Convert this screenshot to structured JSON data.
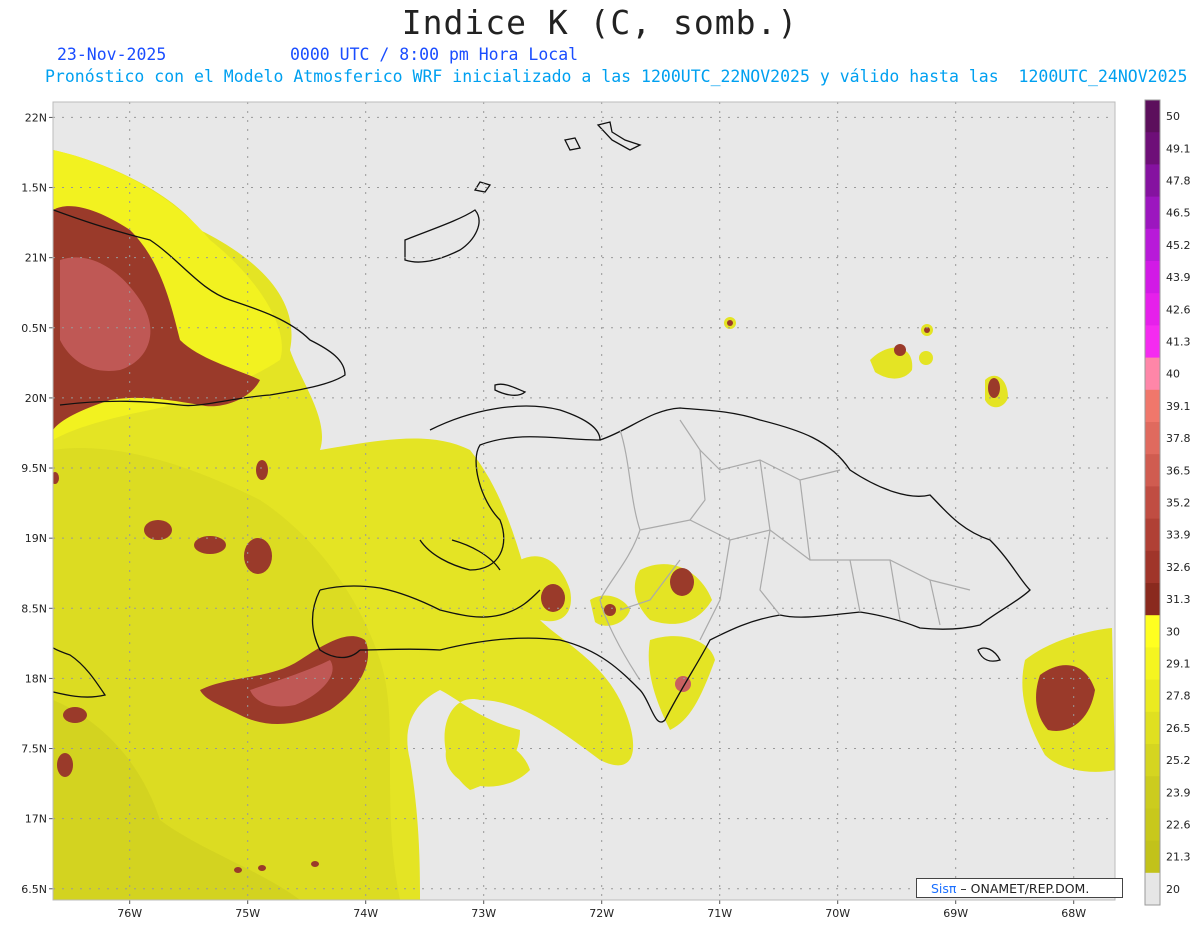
{
  "title": "Indice K (C, somb.)",
  "date": "23-Nov-2025",
  "time": "0000 UTC / 8:00 pm Hora Local",
  "forecast": "Pronóstico con el Modelo Atmosferico WRF inicializado a las 1200UTC_22NOV2025 y válido hasta las  1200UTC_24NOV2025",
  "credit_prefix": "Sisπ",
  "credit_suffix": " – ONAMET/REP.DOM.",
  "map": {
    "lat_range": [
      16.42,
      22.11
    ],
    "lon_range": [
      -76.65,
      -67.65
    ],
    "lat_labels": [
      "22N",
      "1.5N",
      "21N",
      "0.5N",
      "20N",
      "9.5N",
      "19N",
      "8.5N",
      "18N",
      "7.5N",
      "17N",
      "6.5N"
    ],
    "lat_values": [
      22,
      21.5,
      21,
      20.5,
      20,
      19.5,
      19,
      18.5,
      18,
      17.5,
      17,
      16.5
    ],
    "lon_labels": [
      "76W",
      "75W",
      "74W",
      "73W",
      "72W",
      "71W",
      "70W",
      "69W",
      "68W"
    ],
    "lon_values": [
      -76,
      -75,
      -74,
      -73,
      -72,
      -71,
      -70,
      -69,
      -68
    ],
    "background_color": "#e8e8e8"
  },
  "colorbar": {
    "levels": [
      "50",
      "49.1",
      "47.8",
      "46.5",
      "45.2",
      "43.9",
      "42.6",
      "41.3",
      "40",
      "39.1",
      "37.8",
      "36.5",
      "35.2",
      "33.9",
      "32.6",
      "31.3",
      "30",
      "29.1",
      "27.8",
      "26.5",
      "25.2",
      "23.9",
      "22.6",
      "21.3",
      "20"
    ],
    "colors_top_to_bottom": [
      "#5c0f5c",
      "#6e0f78",
      "#8512a0",
      "#9c16bf",
      "#b81ad9",
      "#d21ae6",
      "#e620eb",
      "#f52bf0",
      "#ff86a8",
      "#f0776b",
      "#e06a5e",
      "#d05c50",
      "#c04d42",
      "#b04035",
      "#a0352a",
      "#8a2a1e",
      "#ffff20",
      "#f5f520",
      "#ebeb20",
      "#e0e020",
      "#d5d520",
      "#cccc1e",
      "#c8c81c",
      "#c2c21a",
      "#e6e6e6"
    ]
  }
}
